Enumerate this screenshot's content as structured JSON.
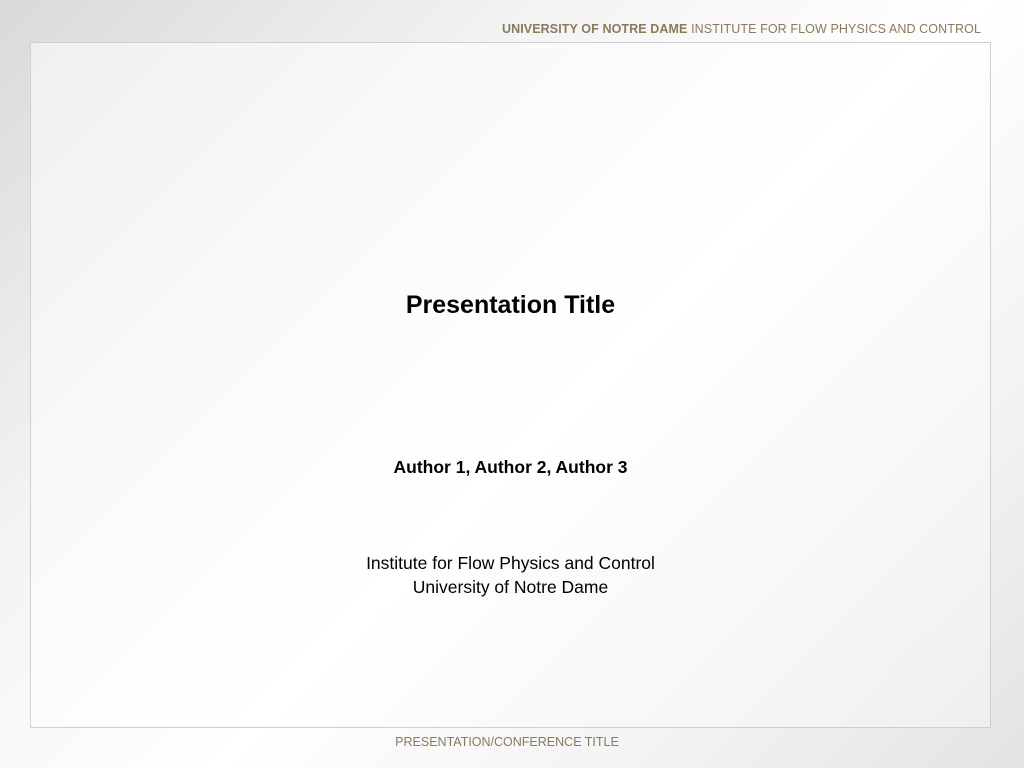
{
  "header": {
    "org": "UNIVERSITY OF NOTRE DAME",
    "institute": "INSTITUTE FOR  FLOW PHYSICS AND CONTROL"
  },
  "slide": {
    "title": "Presentation Title",
    "authors": "Author 1, Author 2, Author 3",
    "affiliation_line1": "Institute for Flow Physics and Control",
    "affiliation_line2": "University of Notre Dame"
  },
  "footer": {
    "conference": "PRESENTATION/CONFERENCE TITLE"
  },
  "colors": {
    "accent_text": "#8a7a5c",
    "frame_border": "#cfcfcf"
  }
}
